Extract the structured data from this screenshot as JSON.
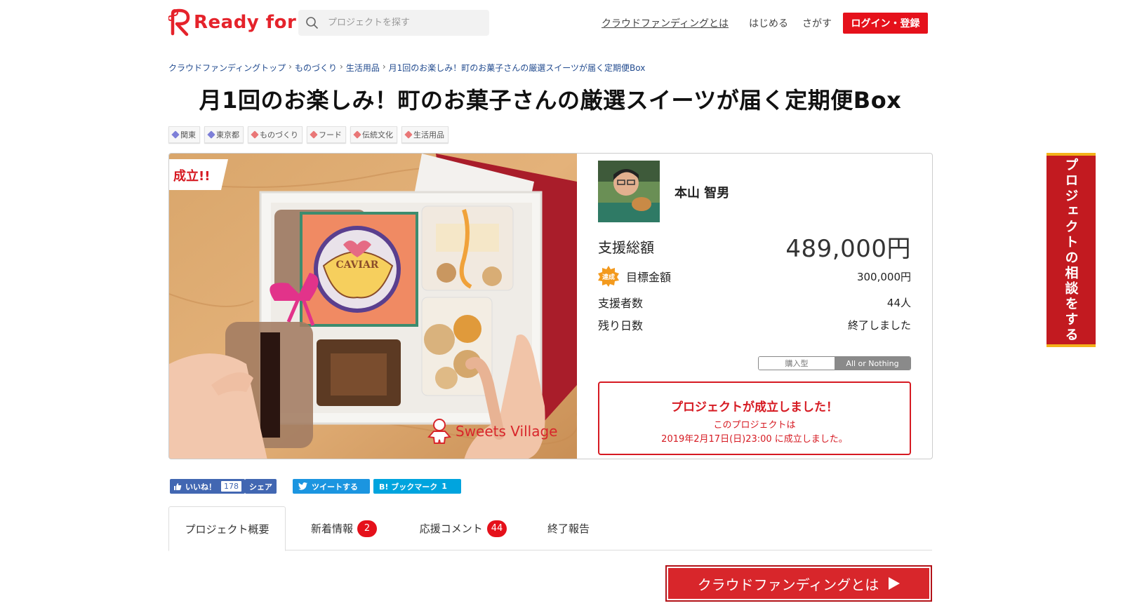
{
  "header": {
    "logo_text": "Ready for",
    "search_placeholder": "プロジェクトを探す",
    "nav_about": "クラウドファンディングとは",
    "nav_start": "はじめる",
    "nav_search": "さがす",
    "login_label": "ログイン・登録"
  },
  "breadcrumb": [
    "クラウドファンディングトップ",
    "ものづくり",
    "生活用品",
    "月1回のお楽しみ！町のお菓子さんの厳選スイーツが届く定期便Box"
  ],
  "breadcrumb_sep": "›",
  "title": "月1回のお楽しみ！町のお菓子さんの厳選スイーツが届く定期便Box",
  "tags": [
    {
      "label": "関東",
      "color": "#7d7fd8"
    },
    {
      "label": "東京都",
      "color": "#7d7fd8"
    },
    {
      "label": "ものづくり",
      "color": "#e97777"
    },
    {
      "label": "フード",
      "color": "#e97777"
    },
    {
      "label": "伝統文化",
      "color": "#e97777"
    },
    {
      "label": "生活用品",
      "color": "#e97777"
    }
  ],
  "hero": {
    "success_flag": "成立!!",
    "brand": "Sweets Village",
    "caviar_label": "CAVIAR"
  },
  "owner": {
    "name": "本山 智男"
  },
  "stats": {
    "total_label": "支援総額",
    "total_value": "489,000円",
    "achieved_badge": "達成",
    "goal_label": "目標金額",
    "goal_value": "300,000円",
    "backers_label": "支援者数",
    "backers_value": "44人",
    "days_label": "残り日数",
    "days_value": "終了しました"
  },
  "type_toggle": {
    "purchase": "購入型",
    "all_or_nothing": "All or Nothing",
    "selected": "All or Nothing"
  },
  "success_box": {
    "heading": "プロジェクトが成立しました！",
    "line1": "このプロジェクトは",
    "line2": "2019年2月17日(日)23:00 に成立しました。"
  },
  "social": {
    "fb_like": "いいね！",
    "fb_like_count": "178",
    "fb_share": "シェア",
    "tweet": "ツイートする",
    "hatena": "B! ブックマーク",
    "hatena_count": "1"
  },
  "tabs": [
    {
      "label": "プロジェクト概要",
      "badge": null,
      "active": true
    },
    {
      "label": "新着情報",
      "badge": "2",
      "active": false
    },
    {
      "label": "応援コメント",
      "badge": "44",
      "active": false
    },
    {
      "label": "終了報告",
      "badge": null,
      "active": false
    }
  ],
  "cf_button": "クラウドファンディングとは",
  "side_tab": "プロジェクトの相談をする",
  "colors": {
    "brand_red": "#e5111b",
    "facebook": "#4267b2",
    "twitter": "#1b95e0",
    "hatena": "#00a4de"
  }
}
